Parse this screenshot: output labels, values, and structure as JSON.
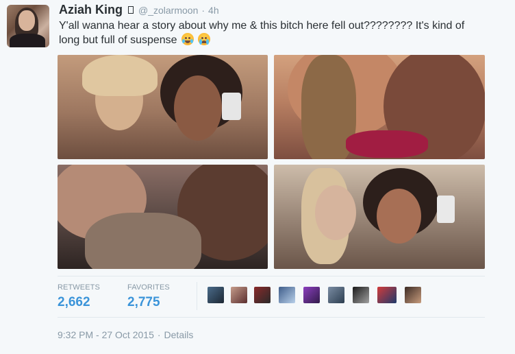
{
  "tweet": {
    "author_name": "Aziah King",
    "handle": "@_zolarmoon",
    "separator": "·",
    "time_ago": "4h",
    "text": "Y'all wanna hear a story about why me & this bitch here fell out???????? It's kind of long but full of suspense",
    "emojis": [
      "face-with-tears-of-joy-emoji",
      "loudly-crying-face-emoji"
    ]
  },
  "media": {
    "photos": [
      {
        "name": "photo-1"
      },
      {
        "name": "photo-2"
      },
      {
        "name": "photo-3"
      },
      {
        "name": "photo-4"
      }
    ]
  },
  "stats": {
    "retweets_label": "RETWEETS",
    "retweets_value": "2,662",
    "favorites_label": "FAVORITES",
    "favorites_value": "2,775"
  },
  "favoriters": {
    "count": 9
  },
  "meta": {
    "timestamp": "9:32 PM - 27 Oct 2015",
    "separator": "·",
    "details_label": "Details"
  },
  "colors": {
    "background": "#f5f8fa",
    "name_text": "#292f33",
    "secondary_text": "#8899a6",
    "stat_value": "#3b94d9",
    "divider": "#e1e8ed"
  }
}
